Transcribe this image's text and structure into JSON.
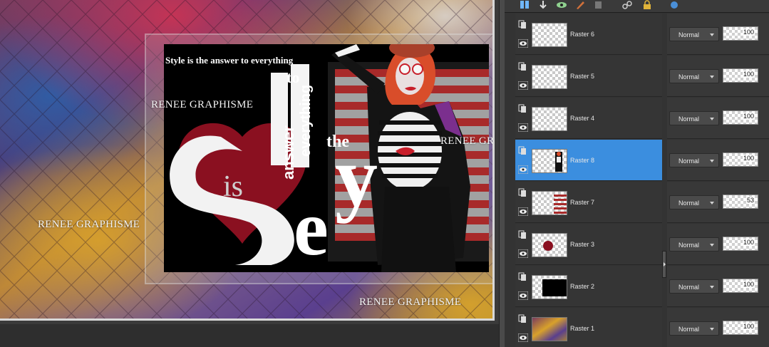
{
  "canvas": {
    "watermarks": [
      "RENEE GRAPHISME",
      "RENEE GRAPHISME",
      "RENEE GRAPHISME",
      "RENEE GRAPHISME"
    ],
    "tagline": "Style is the answer to everything",
    "art_words": {
      "to": "to",
      "answer": "answer",
      "everything": "everything",
      "the": "the",
      "is": "is",
      "y": "y",
      "e": "e"
    }
  },
  "toolbar": {
    "icons": [
      "new-layer-icon",
      "merge-down-icon",
      "visibility-icon",
      "brush-icon",
      "group-icon",
      "link-icon",
      "lock-icon",
      "mask-icon"
    ]
  },
  "layers": [
    {
      "name": "Raster 6",
      "blend": "Normal",
      "opacity": "100",
      "selected": false,
      "thumb": "empty"
    },
    {
      "name": "Raster 5",
      "blend": "Normal",
      "opacity": "100",
      "selected": false,
      "thumb": "empty"
    },
    {
      "name": "Raster 4",
      "blend": "Normal",
      "opacity": "100",
      "selected": false,
      "thumb": "empty"
    },
    {
      "name": "Raster 8",
      "blend": "Normal",
      "opacity": "100",
      "selected": true,
      "thumb": "figure"
    },
    {
      "name": "Raster 7",
      "blend": "Normal",
      "opacity": "53",
      "selected": false,
      "thumb": "stripes"
    },
    {
      "name": "Raster 3",
      "blend": "Normal",
      "opacity": "100",
      "selected": false,
      "thumb": "red-dot"
    },
    {
      "name": "Raster 2",
      "blend": "Normal",
      "opacity": "100",
      "selected": false,
      "thumb": "black-rect"
    },
    {
      "name": "Raster 1",
      "blend": "Normal",
      "opacity": "100",
      "selected": false,
      "thumb": "colorful"
    }
  ],
  "colors": {
    "selection": "#3b8edf",
    "panel_bg": "#333333"
  }
}
